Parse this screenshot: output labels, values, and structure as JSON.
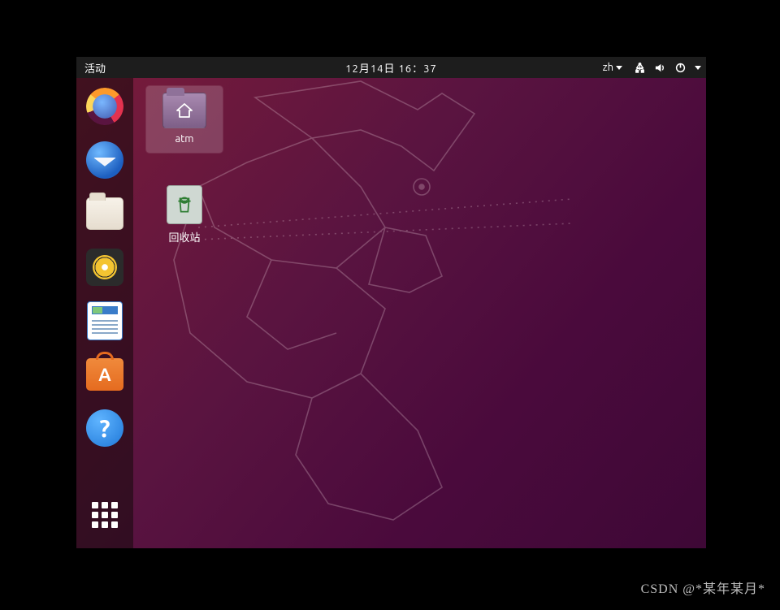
{
  "topbar": {
    "activities": "活动",
    "datetime": "12月14日 16：37",
    "ime": "zh"
  },
  "dock": {
    "items": [
      {
        "name": "firefox"
      },
      {
        "name": "thunderbird"
      },
      {
        "name": "files"
      },
      {
        "name": "rhythmbox"
      },
      {
        "name": "libreoffice-writer"
      },
      {
        "name": "ubuntu-software"
      },
      {
        "name": "help"
      }
    ]
  },
  "desktop": {
    "folder": {
      "label": "atm"
    },
    "trash": {
      "label": "回收站"
    }
  },
  "watermark": "CSDN @*某年某月*"
}
